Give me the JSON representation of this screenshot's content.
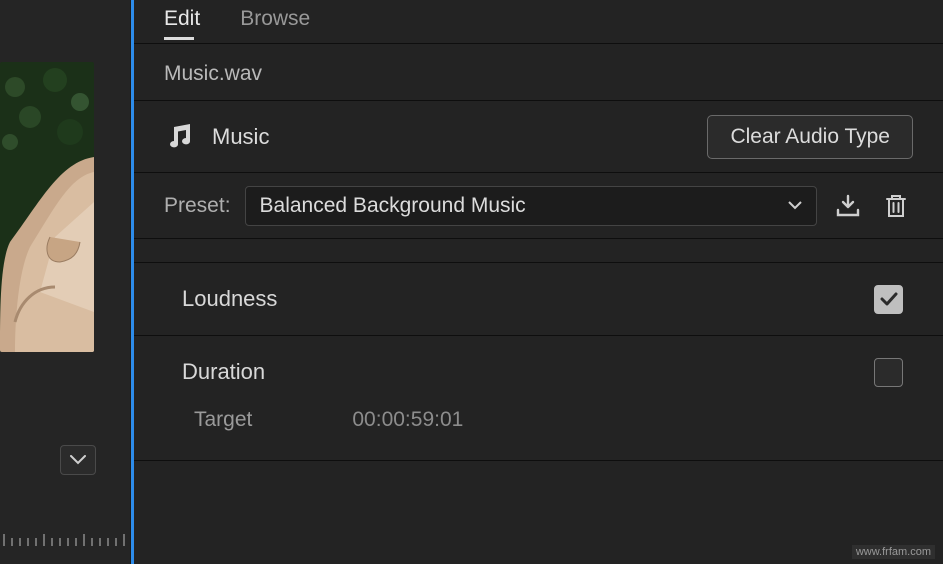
{
  "tabs": {
    "edit": "Edit",
    "browse": "Browse",
    "active": "edit"
  },
  "filename": "Music.wav",
  "audioType": {
    "icon": "music-note-icon",
    "label": "Music",
    "clearBtn": "Clear Audio Type"
  },
  "preset": {
    "label": "Preset:",
    "selected": "Balanced Background Music",
    "saveIcon": "download-preset-icon",
    "deleteIcon": "trash-icon"
  },
  "sections": {
    "loudness": {
      "title": "Loudness",
      "checked": true
    },
    "duration": {
      "title": "Duration",
      "checked": false,
      "target": {
        "label": "Target",
        "value": "00:00:59:01"
      }
    }
  },
  "collapseIcon": "chevron-down-icon",
  "watermark": "www.frfam.com"
}
